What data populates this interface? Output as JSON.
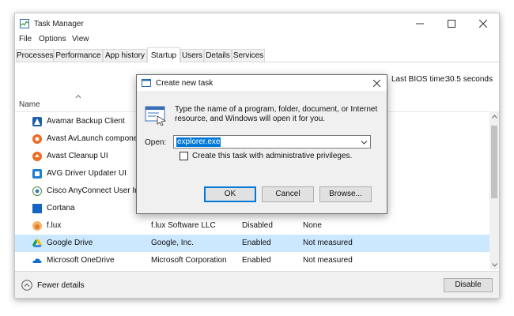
{
  "window": {
    "title": "Task Manager",
    "menu": [
      "File",
      "Options",
      "View"
    ],
    "tabs": [
      "Processes",
      "Performance",
      "App history",
      "Startup",
      "Users",
      "Details",
      "Services"
    ],
    "active_tab": "Startup"
  },
  "bios": {
    "label": "Last BIOS time:",
    "value": "30.5 seconds"
  },
  "columns": {
    "name": "Name"
  },
  "rows": [
    {
      "name": "Avamar Backup Client",
      "publisher": "",
      "status": "",
      "impact": "",
      "icon": "avamar-icon"
    },
    {
      "name": "Avast AvLaunch component",
      "publisher": "",
      "status": "",
      "impact": "",
      "icon": "avast-icon"
    },
    {
      "name": "Avast Cleanup UI",
      "publisher": "",
      "status": "",
      "impact": "",
      "icon": "avast-cleanup-icon"
    },
    {
      "name": "AVG Driver Updater UI",
      "publisher": "",
      "status": "",
      "impact": "",
      "icon": "avg-icon"
    },
    {
      "name": "Cisco AnyConnect User Interface",
      "publisher": "",
      "status": "",
      "impact": "",
      "icon": "cisco-icon"
    },
    {
      "name": "Cortana",
      "publisher": "",
      "status": "",
      "impact": "",
      "icon": "cortana-icon"
    },
    {
      "name": "f.lux",
      "publisher": "f.lux Software LLC",
      "status": "Disabled",
      "impact": "None",
      "icon": "flux-icon"
    },
    {
      "name": "Google Drive",
      "publisher": "Google, Inc.",
      "status": "Enabled",
      "impact": "Not measured",
      "icon": "google-drive-icon"
    },
    {
      "name": "Microsoft OneDrive",
      "publisher": "Microsoft Corporation",
      "status": "Enabled",
      "impact": "Not measured",
      "icon": "onedrive-icon"
    }
  ],
  "selected_row": "Google Drive",
  "footer": {
    "fewer_details": "Fewer details",
    "disable": "Disable"
  },
  "dialog": {
    "title": "Create new task",
    "description": "Type the name of a program, folder, document, or Internet resource, and Windows will open it for you.",
    "open_label": "Open:",
    "open_value": "explorer.exe",
    "admin_label": "Create this task with administrative privileges.",
    "admin_checked": false,
    "ok": "OK",
    "cancel": "Cancel",
    "browse": "Browse..."
  },
  "colors": {
    "accent": "#0078d7",
    "selection": "#cce8ff"
  }
}
